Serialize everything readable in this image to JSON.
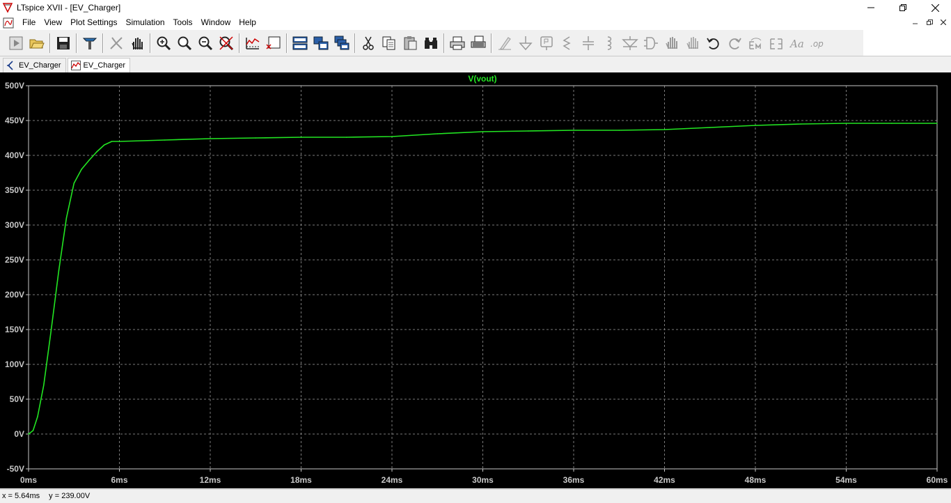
{
  "window": {
    "title": "LTspice XVII - [EV_Charger]"
  },
  "menu": [
    "File",
    "View",
    "Plot Settings",
    "Simulation",
    "Tools",
    "Window",
    "Help"
  ],
  "toolbar": {
    "buttons": [
      "run-icon",
      "open-icon",
      "save-icon",
      "control-panel-icon",
      "halt-icon",
      "pan-icon",
      "zoom-in-icon",
      "zoom-area-icon",
      "zoom-out-icon",
      "zoom-fit-icon",
      "autorange-icon",
      "plot-split-icon",
      "tile-horizontal-icon",
      "tile-vertical-icon",
      "cascade-icon",
      "cut-icon",
      "copy-icon",
      "paste-icon",
      "find-icon",
      "print-icon",
      "print-setup-icon",
      "wire-icon",
      "ground-icon",
      "label-icon",
      "resistor-icon",
      "capacitor-icon",
      "inductor-icon",
      "diode-icon",
      "component-icon",
      "move-icon",
      "drag-icon",
      "undo-icon",
      "redo-icon",
      "rotate-icon",
      "mirror-icon",
      "text-icon",
      "spice-directive-icon"
    ]
  },
  "tabs": [
    {
      "label": "EV_Charger",
      "icon": "schematic-icon"
    },
    {
      "label": "EV_Charger",
      "icon": "waveform-icon"
    }
  ],
  "plot": {
    "trace_label": "V(vout)",
    "trace_color": "#22e622",
    "background": "#000000",
    "grid_color": "#7a7a7a",
    "axis_color": "#c8c8c8"
  },
  "status": {
    "x": "x = 5.64ms",
    "y": "y = 239.00V"
  },
  "chart_data": {
    "type": "line",
    "title": "V(vout)",
    "xlabel": "",
    "ylabel": "",
    "xlim": [
      0,
      60
    ],
    "ylim": [
      -50,
      500
    ],
    "x_ticks": [
      "0ms",
      "6ms",
      "12ms",
      "18ms",
      "24ms",
      "30ms",
      "36ms",
      "42ms",
      "48ms",
      "54ms",
      "60ms"
    ],
    "y_ticks": [
      "500V",
      "450V",
      "400V",
      "350V",
      "300V",
      "250V",
      "200V",
      "150V",
      "100V",
      "50V",
      "0V",
      "-50V"
    ],
    "grid": true,
    "series": [
      {
        "name": "V(vout)",
        "x": [
          0,
          0.3,
          0.6,
          1.0,
          1.5,
          2.0,
          2.5,
          3.0,
          3.5,
          4.0,
          4.5,
          5.0,
          5.5,
          6,
          9,
          12,
          15,
          18,
          21,
          24,
          27,
          30,
          33,
          36,
          39,
          42,
          45,
          48,
          51,
          54,
          57,
          60
        ],
        "y": [
          0,
          5,
          25,
          70,
          150,
          235,
          310,
          360,
          380,
          393,
          405,
          415,
          420,
          420,
          422,
          424,
          425,
          426,
          426,
          427,
          431,
          434,
          435,
          436,
          436,
          437,
          440,
          443,
          445,
          446,
          446,
          446
        ]
      }
    ]
  }
}
